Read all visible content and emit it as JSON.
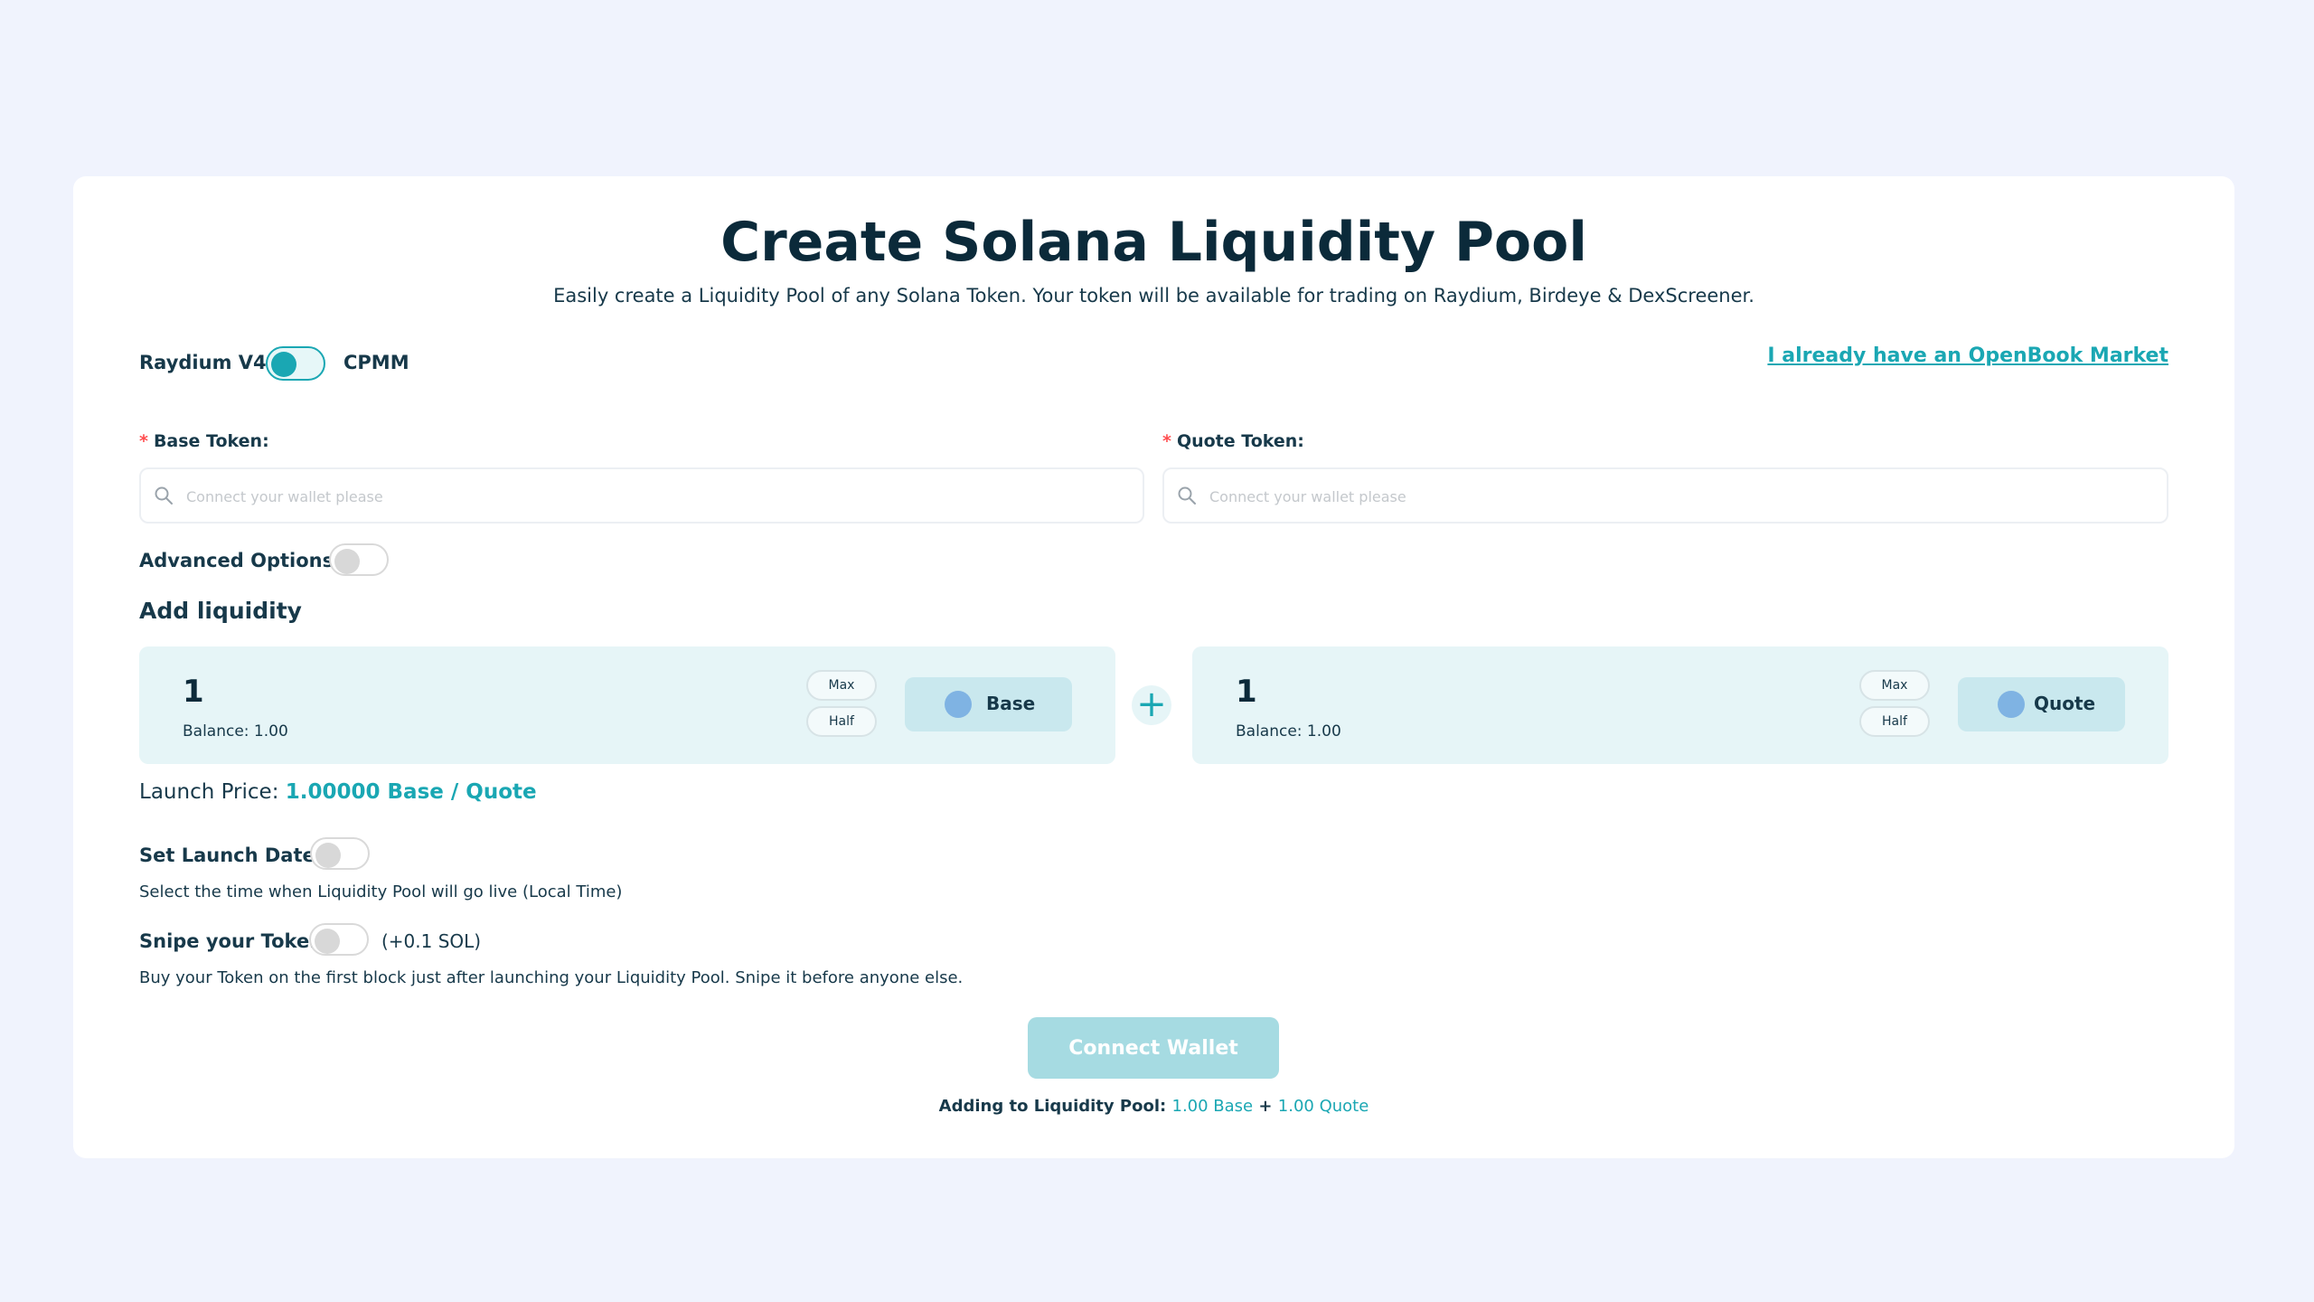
{
  "page": {
    "title": "Create Solana Liquidity Pool",
    "subtitle": "Easily create a Liquidity Pool of any Solana Token. Your token will be available for trading on Raydium, Birdeye & DexScreener."
  },
  "version_toggle": {
    "left_label": "Raydium V4",
    "right_label": "CPMM",
    "state": "on"
  },
  "openbook_link": "I already have an OpenBook Market",
  "base_token": {
    "required_mark": "*",
    "label": "Base Token:",
    "placeholder": "Connect your wallet please"
  },
  "quote_token": {
    "required_mark": "*",
    "label": "Quote Token:",
    "placeholder": "Connect your wallet please"
  },
  "advanced_options": {
    "label": "Advanced Options",
    "state": "off"
  },
  "add_liquidity": {
    "heading": "Add liquidity",
    "base": {
      "amount": "1",
      "balance": "Balance: 1.00",
      "max": "Max",
      "half": "Half",
      "token": "Base"
    },
    "plus": "+",
    "quote": {
      "amount": "1",
      "balance": "Balance: 1.00",
      "max": "Max",
      "half": "Half",
      "token": "Quote"
    }
  },
  "launch_price": {
    "label": "Launch Price:",
    "value": "1.00000 Base / Quote"
  },
  "launch_date": {
    "label": "Set Launch Date",
    "state": "off",
    "description": "Select the time when Liquidity Pool will go live (Local Time)"
  },
  "snipe": {
    "label": "Snipe your Token",
    "state": "off",
    "cost": "(+0.1 SOL)",
    "description": "Buy your Token on the first block just after launching your Liquidity Pool. Snipe it before anyone else."
  },
  "connect_button": "Connect Wallet",
  "summary": {
    "label": "Adding to Liquidity Pool:",
    "base": "1.00 Base",
    "sep": "+",
    "quote": "1.00 Quote"
  },
  "colors": {
    "accent": "#1aa7b3",
    "background": "#f0f3fd",
    "card": "#ffffff",
    "panel": "#e6f5f7",
    "button_disabled": "#a6dbe2"
  }
}
